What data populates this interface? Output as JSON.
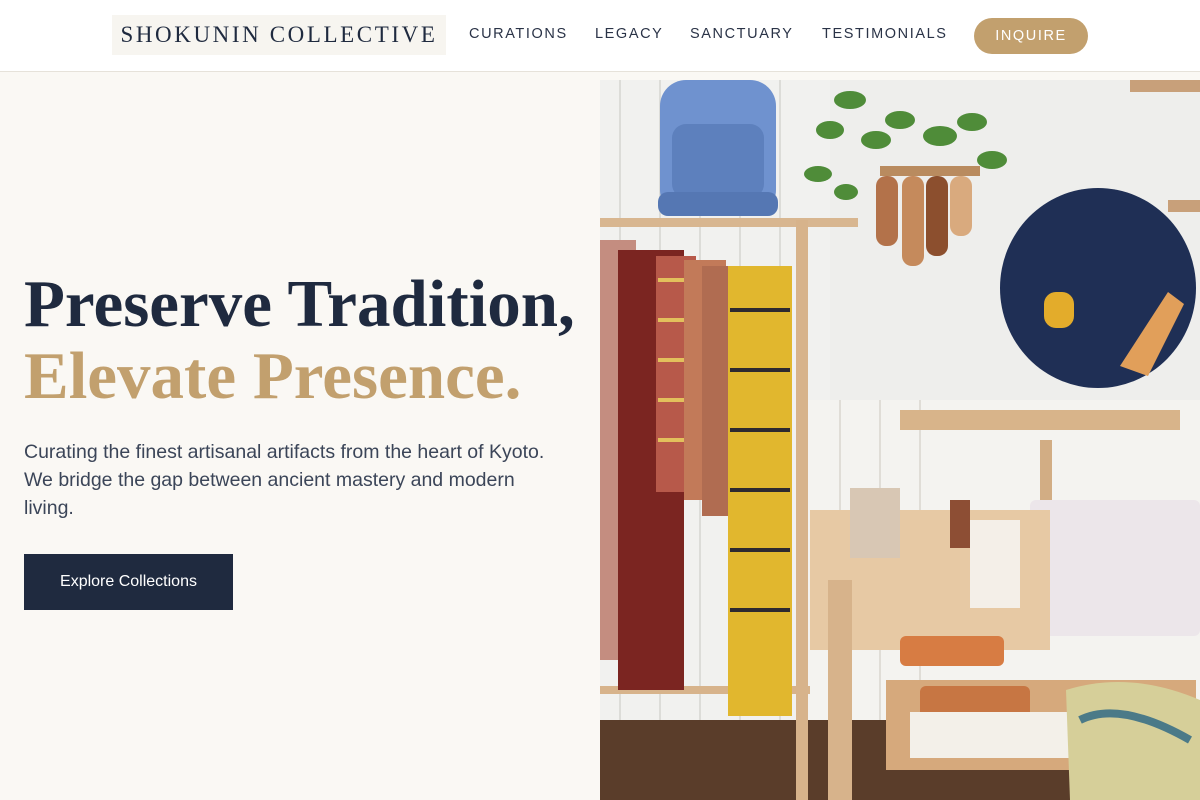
{
  "header": {
    "brand": "SHOKUNIN COLLECTIVE",
    "nav": [
      "CURATIONS",
      "LEGACY",
      "SANCTUARY",
      "TESTIMONIALS"
    ],
    "cta": "INQUIRE"
  },
  "hero": {
    "headline_line1": "Preserve Tradition,",
    "headline_line2": "Elevate Presence.",
    "subtext": "Curating the finest artisanal artifacts from the heart of Kyoto. We bridge the gap between ancient mastery and modern living.",
    "button": "Explore Collections"
  },
  "colors": {
    "navy": "#1f2a3f",
    "gold": "#c2a06e",
    "background": "#faf8f4"
  }
}
